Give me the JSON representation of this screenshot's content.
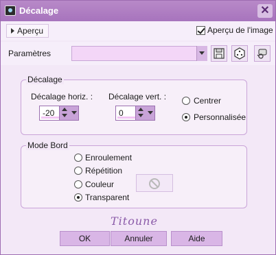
{
  "window": {
    "title": "Décalage",
    "close_label": "✕"
  },
  "toolbar": {
    "apercu_label": "Aperçu",
    "apercu_image_label": "Aperçu de l'image",
    "apercu_image_checked": true
  },
  "params": {
    "label": "Paramètres",
    "preset_value": "",
    "icons": [
      "save-icon",
      "random-dice-icon",
      "reset-icon"
    ]
  },
  "offset": {
    "group_title": "Décalage",
    "horiz_label": "Décalage horiz. :",
    "horiz_value": "-20",
    "vert_label": "Décalage vert. :",
    "vert_value": "0",
    "centrer_label": "Centrer",
    "personnalisee_label": "Personnalisée",
    "selected": "Personnalisée"
  },
  "edge": {
    "group_title": "Mode Bord",
    "options": [
      "Enroulement",
      "Répétition",
      "Couleur",
      "Transparent"
    ],
    "selected": "Transparent"
  },
  "signature": "Titoune",
  "buttons": {
    "ok": "OK",
    "cancel": "Annuler",
    "help": "Aide"
  },
  "colors": {
    "titlebar": "#a774bd",
    "accent": "#d9b6e6",
    "background": "#f3e8f7"
  }
}
